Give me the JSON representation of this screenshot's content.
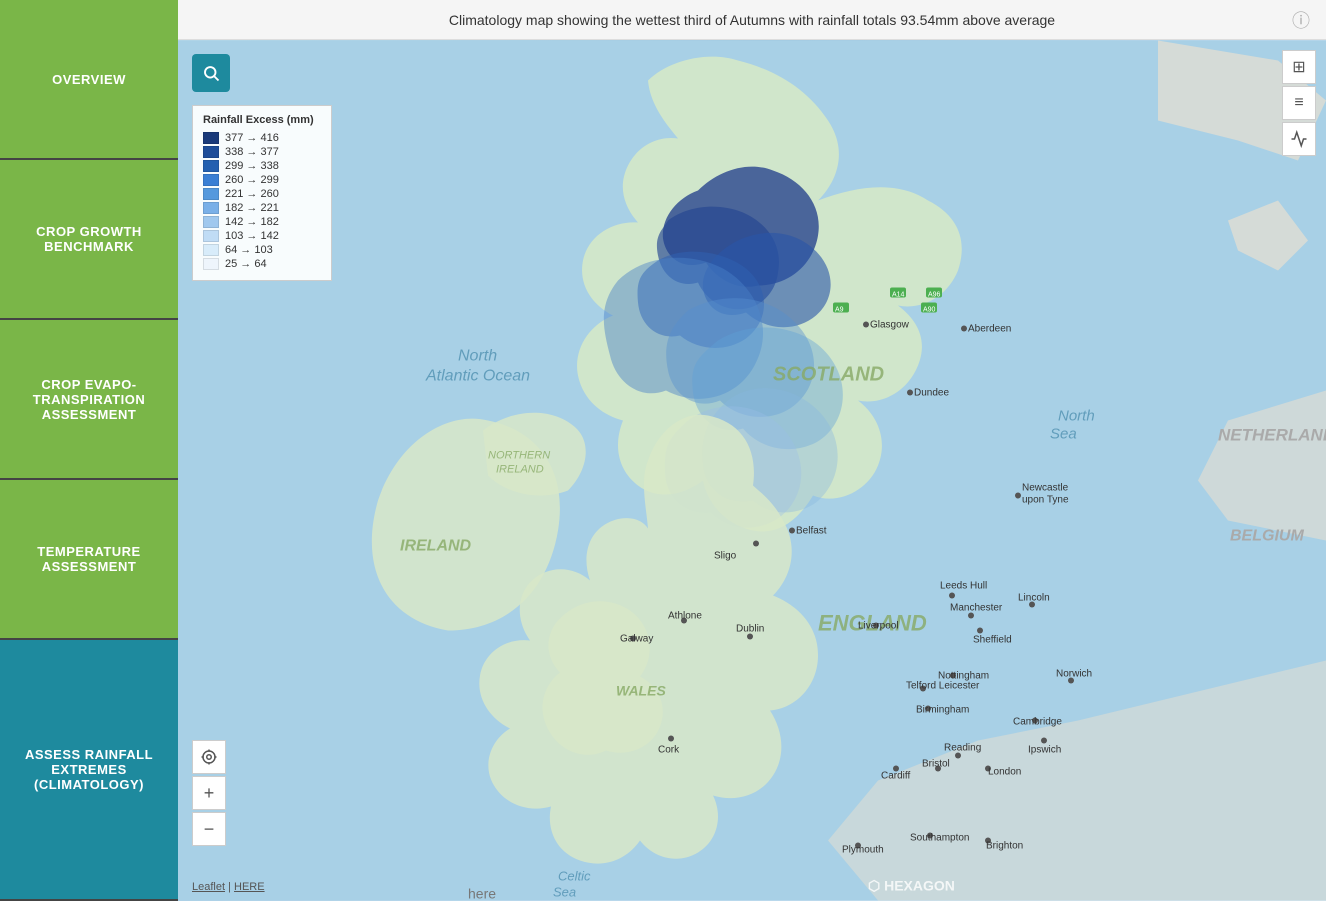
{
  "sidebar": {
    "items": [
      {
        "id": "overview",
        "label": "OVERVIEW",
        "style": "overview"
      },
      {
        "id": "crop-growth",
        "label": "CROP GROWTH BENCHMARK",
        "style": "crop-growth"
      },
      {
        "id": "crop-evapo",
        "label": "CROP EVAPO-TRANSPIRATION ASSESSMENT",
        "style": "crop-evapo"
      },
      {
        "id": "temperature",
        "label": "TEMPERATURE ASSESSMENT",
        "style": "temperature"
      },
      {
        "id": "rainfall",
        "label": "ASSESS RAINFALL EXTREMES (CLIMATOLOGY)",
        "style": "rainfall"
      }
    ]
  },
  "map": {
    "title": "Climatology map showing the wettest third of Autumns with rainfall totals 93.54mm above average",
    "search_tooltip": "Search",
    "legend_title": "Rainfall Excess (mm)",
    "legend_items": [
      {
        "label": "377 → 416",
        "color": "#1a3a7a"
      },
      {
        "label": "338 → 377",
        "color": "#1e4d99"
      },
      {
        "label": "299 → 338",
        "color": "#2460b0"
      },
      {
        "label": "260 → 299",
        "color": "#3a7fd4"
      },
      {
        "label": "221 → 260",
        "color": "#5599dd"
      },
      {
        "label": "182 → 221",
        "color": "#7ab0e8"
      },
      {
        "label": "142 → 182",
        "color": "#a0c8ee"
      },
      {
        "label": "103 → 142",
        "color": "#c0dcf5"
      },
      {
        "label": "64 → 103",
        "color": "#d8ecfa"
      },
      {
        "label": "25 → 64",
        "color": "#eef5fc"
      }
    ],
    "zoom_in_label": "+",
    "zoom_out_label": "−",
    "attribution_leaflet": "Leaflet",
    "attribution_separator": " | ",
    "attribution_here": "HERE",
    "hexagon_label": "⬡ HEXAGON",
    "controls": {
      "grid_icon": "⊞",
      "menu_icon": "≡",
      "chart_icon": "📊"
    }
  }
}
